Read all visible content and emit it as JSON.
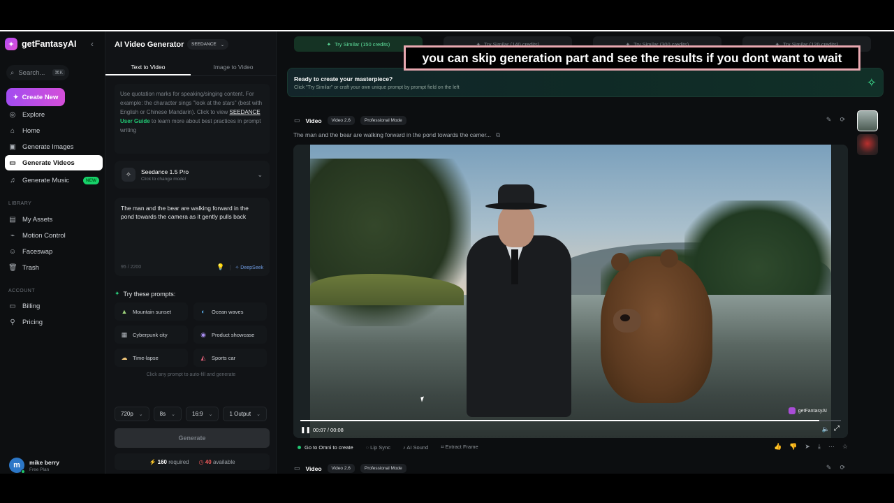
{
  "app": {
    "brand": "getFantasyAI",
    "search_placeholder": "Search...",
    "search_kbd": "⌘K",
    "create_new": "Create New"
  },
  "sidebar": {
    "items": [
      {
        "label": "Explore",
        "icon": "compass-icon"
      },
      {
        "label": "Home",
        "icon": "home-icon"
      },
      {
        "label": "Generate Images",
        "icon": "image-icon"
      },
      {
        "label": "Generate Videos",
        "icon": "video-icon",
        "active": true
      },
      {
        "label": "Generate Music",
        "icon": "music-icon",
        "badge": "NEW"
      }
    ],
    "library_label": "LIBRARY",
    "library_items": [
      {
        "label": "My Assets",
        "icon": "folder-icon"
      },
      {
        "label": "Motion Control",
        "icon": "motion-icon"
      },
      {
        "label": "Faceswap",
        "icon": "faceswap-icon"
      },
      {
        "label": "Trash",
        "icon": "trash-icon"
      }
    ],
    "account_label": "ACCOUNT",
    "account_items": [
      {
        "label": "Billing",
        "icon": "card-icon"
      },
      {
        "label": "Pricing",
        "icon": "pricing-icon"
      }
    ],
    "user": {
      "initial": "m",
      "name": "mike berry",
      "plan": "Free Plan"
    }
  },
  "panel": {
    "title": "AI Video Generator",
    "model_pill": "SEEDANCE",
    "tabs": [
      "Text to Video",
      "Image to Video"
    ],
    "hint": {
      "text1": "Use quotation marks for speaking/singing content. For example: the character sings \"look at the stars\" (best with English or Chinese Mandarin). Click to view",
      "link": "SEEDANCE",
      "guide": "User Guide",
      "text2": "to learn more about best practices in prompt writing"
    },
    "model": {
      "name": "Seedance 1.5 Pro",
      "sub": "Click to change model"
    },
    "prompt": {
      "text": "The man and the bear are walking forward in the pond towards the camera as it gently pulls back",
      "count": "95 / 2200",
      "enhancer": "DeepSeek"
    },
    "try_title": "Try these prompts:",
    "chips": [
      {
        "label": "Mountain sunset",
        "icon": "mountain-icon"
      },
      {
        "label": "Ocean waves",
        "icon": "wave-icon"
      },
      {
        "label": "Cyberpunk city",
        "icon": "city-icon"
      },
      {
        "label": "Product showcase",
        "icon": "product-icon"
      },
      {
        "label": "Time-lapse",
        "icon": "cloud-icon"
      },
      {
        "label": "Sports car",
        "icon": "car-icon"
      }
    ],
    "try_foot": "Click any prompt to auto-fill and generate",
    "options": {
      "resolution": "720p",
      "duration": "8s",
      "ratio": "16:9",
      "outputs": "1 Output"
    },
    "generate": "Generate",
    "credits": {
      "required": "160",
      "required_label": "required",
      "available": "40",
      "available_label": "available"
    }
  },
  "main": {
    "similar": [
      "Try Similar (150 credits)",
      "Try Similar (140 credits)",
      "Try Similar (300 credits)",
      "Try Similar (120 credits)"
    ],
    "ready_title": "Ready to create your masterpiece?",
    "ready_sub": "Click \"Try Similar\" or craft your own unique prompt by prompt field on the left",
    "card": {
      "type": "Video",
      "tags": [
        "Video 2.6",
        "Professional Mode"
      ],
      "description": "The man and the bear are walking forward in the pond towards the camer...",
      "watermark": "getFantasyAI",
      "time": "00:07 / 00:08",
      "progress": 0.96,
      "actions": [
        "Go to Omni to create",
        "Lip Sync",
        "AI Sound",
        "Extract Frame"
      ]
    },
    "card2": {
      "type": "Video",
      "tags": [
        "Video 2.6",
        "Professional Mode"
      ]
    }
  },
  "callout": "you can skip generation part and see the results if you dont want to wait"
}
